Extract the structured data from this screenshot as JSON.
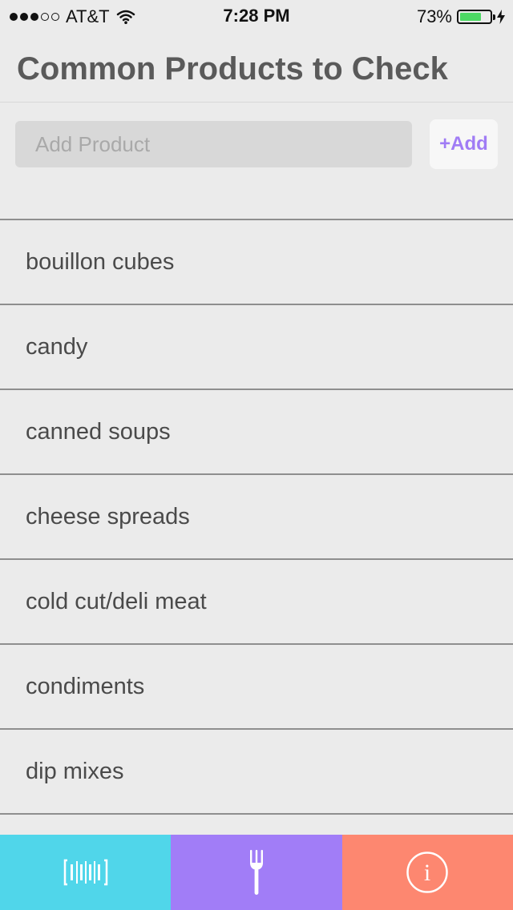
{
  "status_bar": {
    "carrier": "AT&T",
    "signal_bars_filled": 3,
    "signal_bars_total": 5,
    "time": "7:28 PM",
    "battery_percent": "73%",
    "battery_level": 0.73,
    "icons": [
      "wifi-icon",
      "battery-icon",
      "charging-bolt-icon"
    ]
  },
  "header": {
    "title": "Common Products to Check"
  },
  "add_product": {
    "placeholder": "Add Product",
    "value": "",
    "button_label": "+Add"
  },
  "products": [
    {
      "label": "bouillon cubes"
    },
    {
      "label": "candy"
    },
    {
      "label": "canned soups"
    },
    {
      "label": "cheese spreads"
    },
    {
      "label": "cold cut/deli meat"
    },
    {
      "label": "condiments"
    },
    {
      "label": "dip mixes"
    }
  ],
  "tab_bar": {
    "tabs": [
      {
        "icon": "barcode-scanner-icon",
        "color": "#50d6ea"
      },
      {
        "icon": "fork-icon",
        "color": "#a17df7"
      },
      {
        "icon": "info-icon",
        "color": "#fd8770"
      }
    ]
  },
  "colors": {
    "background": "#ebebeb",
    "accent": "#a07cf5",
    "text": "#4a4a4a"
  }
}
